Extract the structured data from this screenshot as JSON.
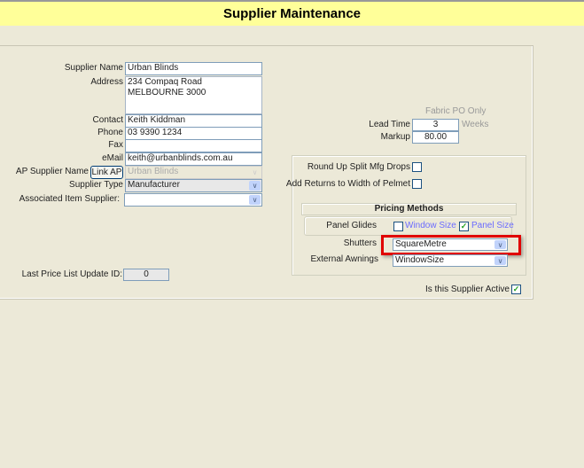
{
  "title": "Supplier Maintenance",
  "form": {
    "supplier_name_label": "Supplier Name",
    "supplier_name": "Urban Blinds",
    "address_label": "Address",
    "address": "234 Compaq Road\nMELBOURNE 3000",
    "contact_label": "Contact",
    "contact": "Keith Kiddman",
    "phone_label": "Phone",
    "phone": "03 9390 1234",
    "fax_label": "Fax",
    "fax": "",
    "email_label": "eMail",
    "email": "keith@urbanblinds.com.au",
    "ap_supplier_label": "AP Supplier Name",
    "link_ap_button": "Link AP",
    "ap_supplier": "Urban Blinds",
    "supplier_type_label": "Supplier Type",
    "supplier_type": "Manufacturer",
    "associated_item_label": "Associated Item Supplier:",
    "associated_item": "",
    "last_price_label": "Last Price List Update ID:",
    "last_price": "0"
  },
  "right": {
    "fabric_po_only": "Fabric PO Only",
    "lead_time_label": "Lead Time",
    "lead_time": "3",
    "weeks": "Weeks",
    "markup_label": "Markup",
    "markup": "80.00",
    "round_up_label": "Round Up Split Mfg Drops",
    "round_up_checked": false,
    "add_returns_label": "Add Returns to Width of Pelmet",
    "add_returns_checked": false,
    "pricing_methods": "Pricing Methods",
    "panel_glides_label": "Panel Glides",
    "window_size_label": "Window Size",
    "window_size_checked": false,
    "panel_size_label": "Panel Size",
    "panel_size_checked": true,
    "shutters_label": "Shutters",
    "shutters": "SquareMetre",
    "awnings_label": "External Awnings",
    "awnings": "WindowSize",
    "active_label": "Is this Supplier Active",
    "active_checked": true
  },
  "colors": {
    "title_bg": "#ffff99",
    "highlight": "#e00000"
  }
}
